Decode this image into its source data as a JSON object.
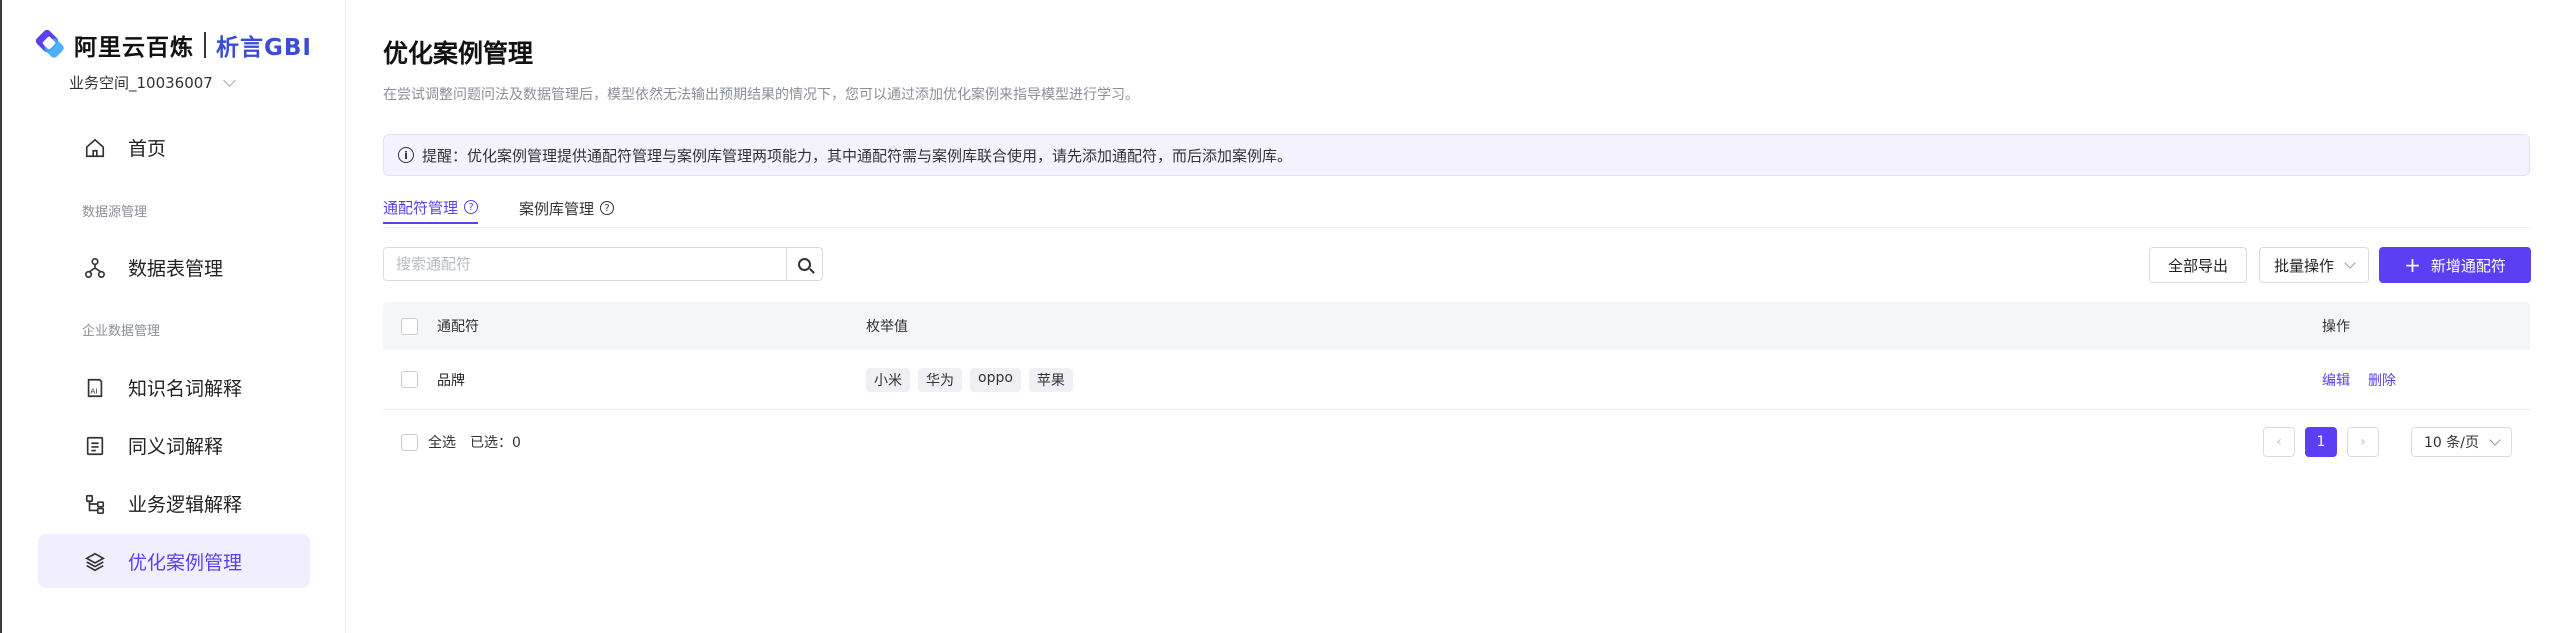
{
  "brand": {
    "name": "阿里云百炼",
    "product": "析言GBI",
    "workspace": "业务空间_10036007"
  },
  "sidebar": {
    "home": "首页",
    "group_datasource": "数据源管理",
    "tables": "数据表管理",
    "group_enterprise": "企业数据管理",
    "knowledge_terms": "知识名词解释",
    "synonyms": "同义词解释",
    "business_logic": "业务逻辑解释",
    "optimization_cases": "优化案例管理"
  },
  "page": {
    "title": "优化案例管理",
    "description": "在尝试调整问题问法及数据管理后，模型依然无法输出预期结果的情况下，您可以通过添加优化案例来指导模型进行学习。",
    "notice": "提醒：优化案例管理提供通配符管理与案例库管理两项能力，其中通配符需与案例库联合使用，请先添加通配符，而后添加案例库。"
  },
  "tabs": {
    "wildcard": "通配符管理",
    "case_library": "案例库管理"
  },
  "toolbar": {
    "search_placeholder": "搜索通配符",
    "export_all": "全部导出",
    "batch_ops": "批量操作",
    "add_wildcard": "新增通配符"
  },
  "table": {
    "headers": {
      "wildcard": "通配符",
      "enum_values": "枚举值",
      "actions": "操作"
    },
    "rows": [
      {
        "wildcard": "品牌",
        "values": [
          "小米",
          "华为",
          "oppo",
          "苹果"
        ],
        "edit": "编辑",
        "delete": "删除"
      }
    ]
  },
  "footer": {
    "select_all": "全选",
    "selected": "已选：0"
  },
  "pagination": {
    "current_page": "1",
    "page_size": "10 条/页"
  },
  "colors": {
    "primary": "#5b3ff5",
    "active_bg": "#f1efff"
  }
}
